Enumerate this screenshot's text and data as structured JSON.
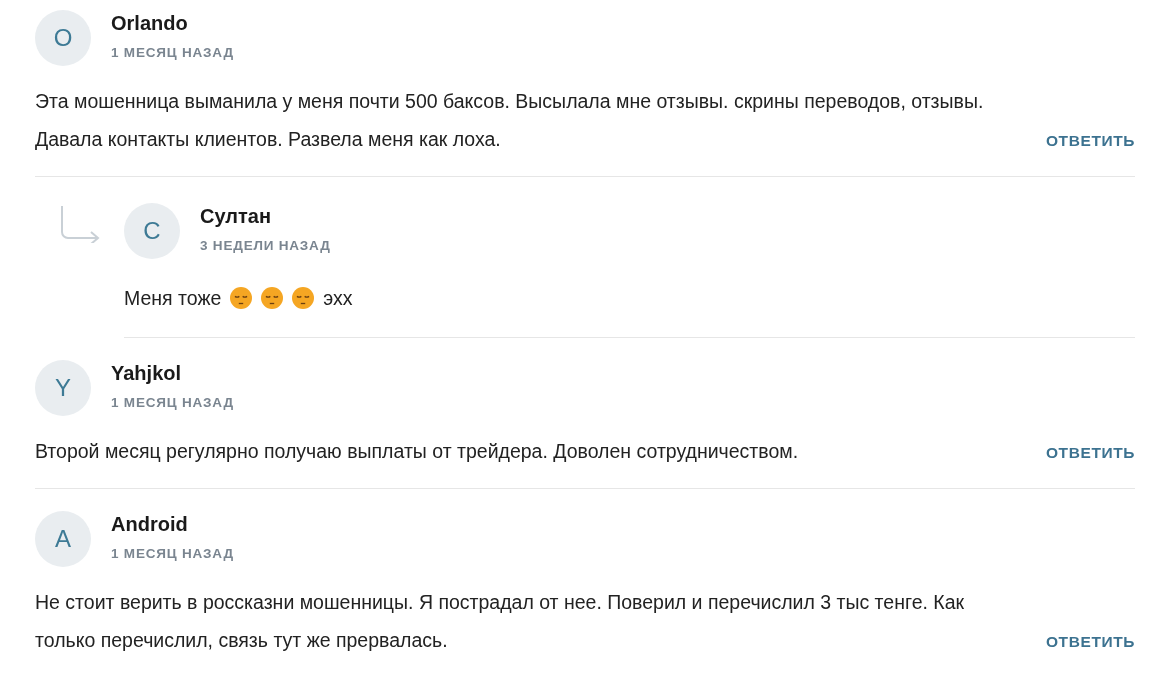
{
  "comments": [
    {
      "initial": "O",
      "author": "Orlando",
      "date": "1 МЕСЯЦ НАЗАД",
      "body": [
        {
          "kind": "text",
          "text": "Эта мошенница выманила у меня почти 500 баксов. Высылала мне отзывы. скрины переводов, отзывы. Давала контакты клиентов. Развела меня как лоха."
        }
      ],
      "reply_label": "ОТВЕТИТЬ",
      "replies": [
        {
          "initial": "С",
          "author": "Султан",
          "date": "3 НЕДЕЛИ НАЗАД",
          "body": [
            {
              "kind": "text",
              "text": "Меня тоже"
            },
            {
              "kind": "emoji"
            },
            {
              "kind": "emoji"
            },
            {
              "kind": "emoji"
            },
            {
              "kind": "text",
              "text": "эхх"
            }
          ]
        }
      ]
    },
    {
      "initial": "Y",
      "author": "Yahjkol",
      "date": "1 МЕСЯЦ НАЗАД",
      "body": [
        {
          "kind": "text",
          "text": "Второй месяц регулярно получаю выплаты от трейдера. Доволен сотрудничеством."
        }
      ],
      "reply_label": "ОТВЕТИТЬ"
    },
    {
      "initial": "A",
      "author": "Android",
      "date": "1 МЕСЯЦ НАЗАД",
      "body": [
        {
          "kind": "text",
          "text": "Не стоит верить в россказни мошенницы. Я пострадал от нее. Поверил и перечислил 3 тыс тенге. Как только перечислил, связь тут же прервалась."
        }
      ],
      "reply_label": "ОТВЕТИТЬ"
    }
  ]
}
